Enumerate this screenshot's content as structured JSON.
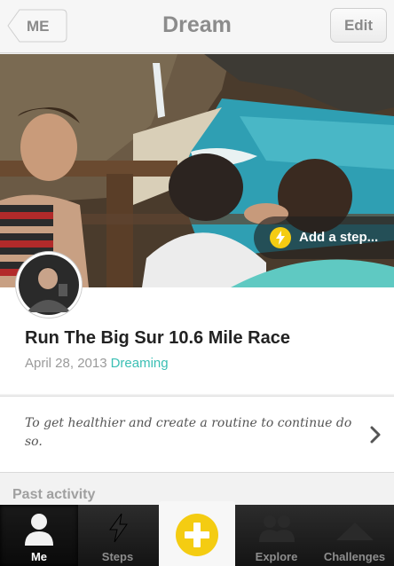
{
  "header": {
    "back_label": "ME",
    "title": "Dream",
    "edit_label": "Edit"
  },
  "hero": {
    "add_step_label": "Add a step...",
    "add_step_icon": "lightning-bolt-icon"
  },
  "dream": {
    "title": "Run The Big Sur 10.6 Mile Race",
    "date": "April 28, 2013",
    "status": "Dreaming",
    "reason": "To get healthier and create a routine to continue do so."
  },
  "section": {
    "past_activity": "Past activity"
  },
  "tabs": [
    {
      "label": "Me",
      "icon": "person-icon"
    },
    {
      "label": "Steps",
      "icon": "lightning-bolt-icon"
    },
    {
      "label": "",
      "icon": "plus-icon"
    },
    {
      "label": "Explore",
      "icon": "people-icon"
    },
    {
      "label": "Challenges",
      "icon": "mountain-icon"
    }
  ],
  "colors": {
    "accent_yellow": "#f4cc12",
    "status_teal": "#3bbfb4",
    "tabbar_dark": "#1a1a1a"
  }
}
